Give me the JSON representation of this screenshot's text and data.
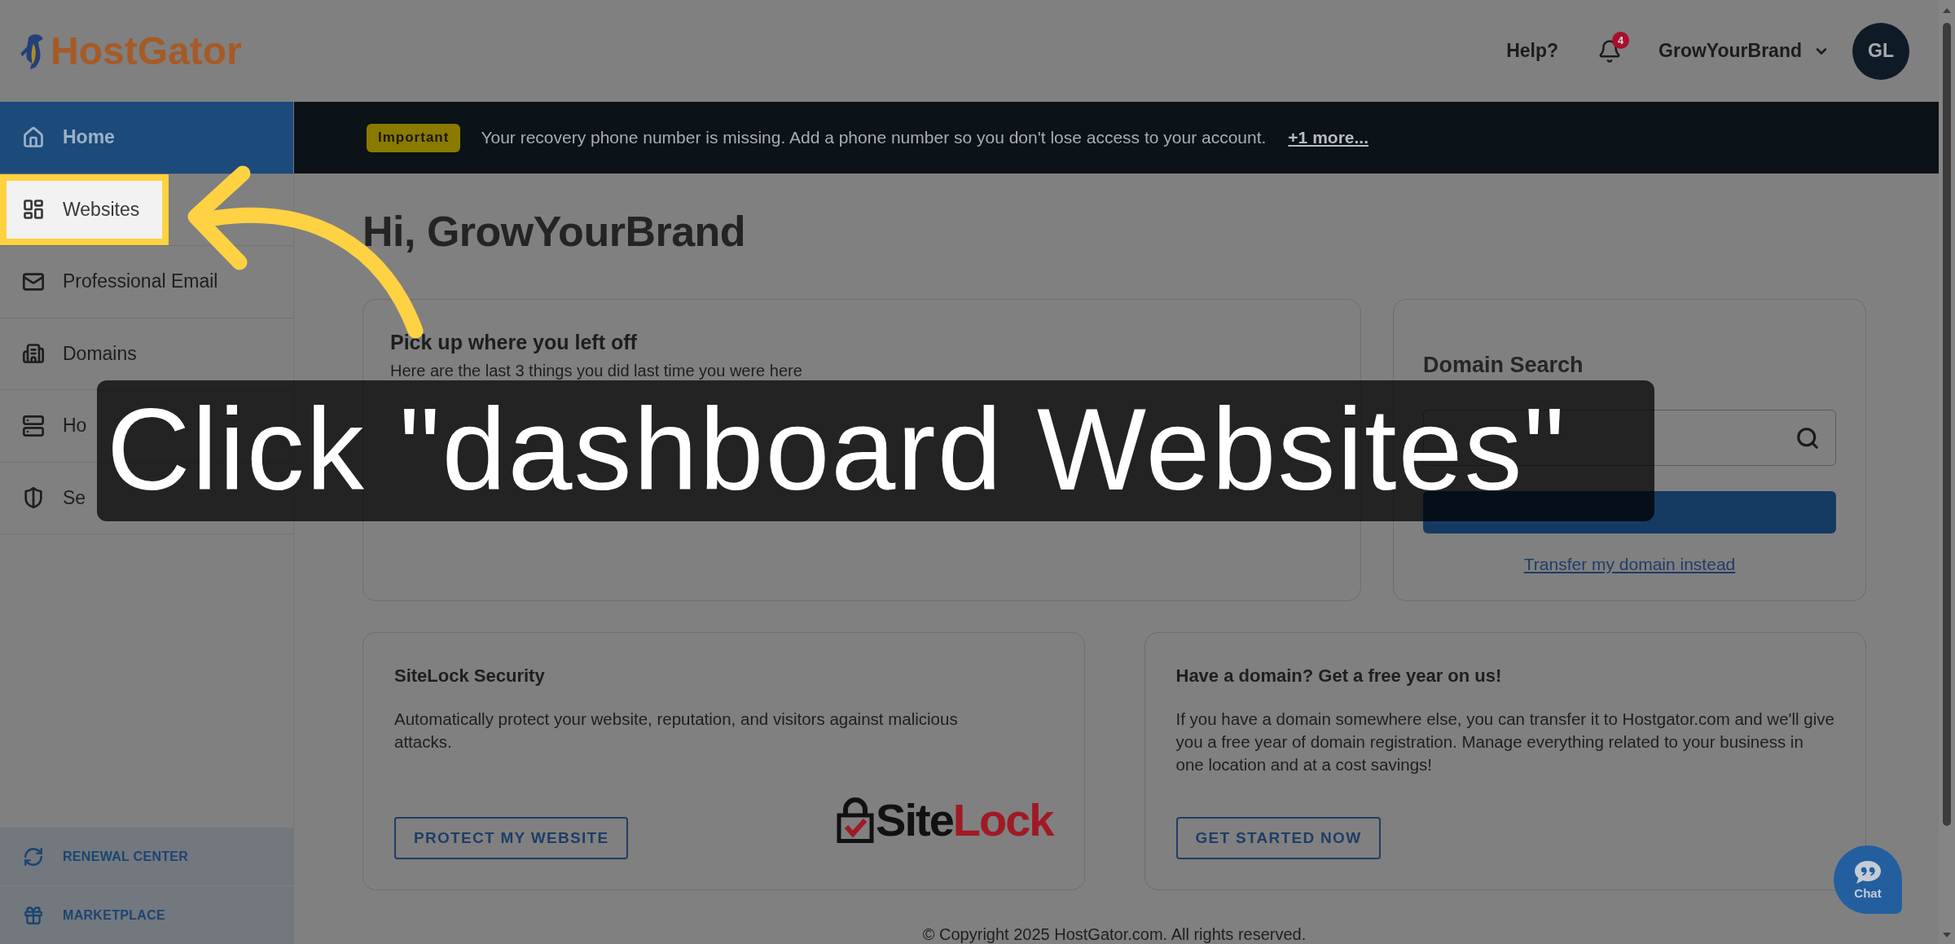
{
  "header": {
    "logo": "HostGator",
    "help": "Help?",
    "notification_count": "4",
    "account_name": "GrowYourBrand",
    "avatar_initials": "GL"
  },
  "sidebar": {
    "items": [
      {
        "label": "Home",
        "selected": true,
        "highlighted": false
      },
      {
        "label": "Websites",
        "selected": false,
        "highlighted": true
      },
      {
        "label": "Professional Email",
        "selected": false,
        "highlighted": false
      },
      {
        "label": "Domains",
        "selected": false,
        "highlighted": false
      },
      {
        "label": "Ho",
        "selected": false,
        "highlighted": false
      },
      {
        "label": "Se",
        "selected": false,
        "highlighted": false
      }
    ],
    "footer_links": [
      "RENEWAL CENTER",
      "MARKETPLACE"
    ]
  },
  "alert": {
    "badge": "Important",
    "message": "Your recovery phone number is missing. Add a phone number so you don't lose access to your account.",
    "link": "+1 more..."
  },
  "greeting": "Hi, GrowYourBrand",
  "recent_card": {
    "title": "Pick up where you left off",
    "subtitle": "Here are the last 3 things you did last time you were here"
  },
  "domain_search": {
    "title": "Domain Search",
    "link": "Transfer my domain instead"
  },
  "promo_cards": [
    {
      "kind": "sitelock",
      "title": "SiteLock Security",
      "text": "Automatically protect your website, reputation, and visitors against malicious attacks.",
      "button": "PROTECT MY WEBSITE",
      "logo": [
        {
          "text": "Site",
          "color": "#111111"
        },
        {
          "text": "Lock",
          "color": "#9f1a24"
        }
      ]
    },
    {
      "kind": "plain",
      "title": "Have a domain? Get a free year on us!",
      "text": "If you have a domain somewhere else, you can transfer it to Hostgator.com and we'll give you a free year of domain registration. Manage everything related to your business in one location and at a cost savings!",
      "button": "GET STARTED NOW"
    }
  ],
  "footer": {
    "copyright": "© Copyright 2025 HostGator.com. All rights reserved."
  },
  "chat": {
    "label": "Chat"
  },
  "tutorial": {
    "caption": "Click \"dashboard Websites\""
  }
}
